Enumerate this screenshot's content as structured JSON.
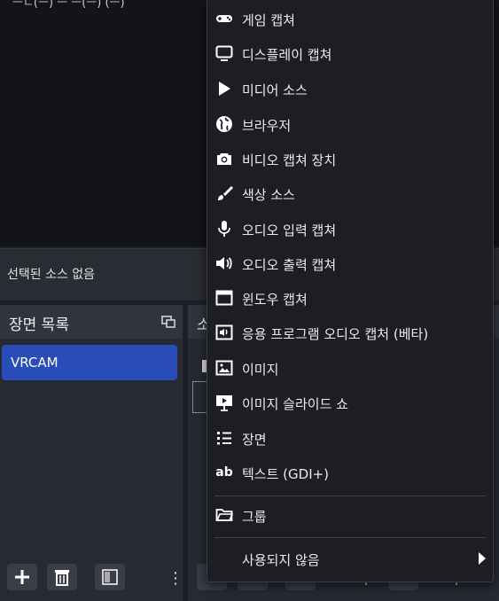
{
  "preview": {
    "top_text": "ㅡㄷ(ㅡ)  ㅡ  ㅡ(ㅡ)      (ㅡ)"
  },
  "no_source_text": "선택된 소스 없음",
  "scenes": {
    "title": "장면 목록",
    "items": [
      "VRCAM"
    ]
  },
  "sources": {
    "title": "소"
  },
  "menu": {
    "items": [
      {
        "label": "게임 캡쳐",
        "icon": "gamepad-icon"
      },
      {
        "label": "디스플레이 캡쳐",
        "icon": "monitor-icon"
      },
      {
        "label": "미디어 소스",
        "icon": "play-icon"
      },
      {
        "label": "브라우저",
        "icon": "globe-icon"
      },
      {
        "label": "비디오 캡쳐 장치",
        "icon": "camera-icon"
      },
      {
        "label": "색상 소스",
        "icon": "brush-icon"
      },
      {
        "label": "오디오 입력 캡쳐",
        "icon": "microphone-icon"
      },
      {
        "label": "오디오 출력 캡쳐",
        "icon": "speaker-icon"
      },
      {
        "label": "윈도우 캡쳐",
        "icon": "window-icon"
      },
      {
        "label": "응용 프로그램 오디오 캡처 (베타)",
        "icon": "app-audio-icon"
      },
      {
        "label": "이미지",
        "icon": "image-icon"
      },
      {
        "label": "이미지 슬라이드 쇼",
        "icon": "slideshow-icon"
      },
      {
        "label": "장면",
        "icon": "list-icon"
      },
      {
        "label": "텍스트 (GDI+)",
        "icon": "text-ab-icon"
      }
    ],
    "group": {
      "label": "그룹",
      "icon": "folder-icon"
    },
    "deprecated": {
      "label": "사용되지 않음"
    }
  },
  "colors": {
    "accent": "#284cb8",
    "menu_bg": "#1d1e23",
    "dock_bg": "#272a33"
  }
}
